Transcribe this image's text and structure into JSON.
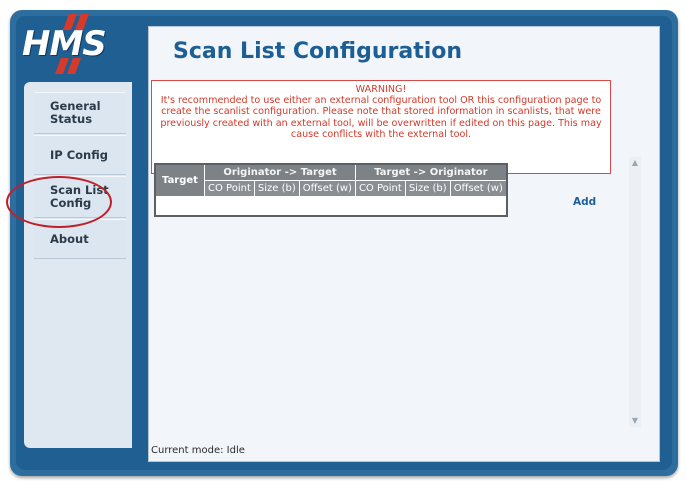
{
  "brand": {
    "logo_text": "HMS",
    "accent": "#d63a2a",
    "frame": "#2e6e9e"
  },
  "sidebar": {
    "items": [
      {
        "label_line1": "General",
        "label_line2": "Status"
      },
      {
        "label_line1": "IP Config",
        "label_line2": ""
      },
      {
        "label_line1": "Scan List",
        "label_line2": "Config",
        "selected": true
      },
      {
        "label_line1": "About",
        "label_line2": ""
      }
    ]
  },
  "main": {
    "title": "Scan List Configuration",
    "warning": {
      "head": "WARNING!",
      "body": "It's recommended to use either an external configuration tool OR this configuration page to create the scanlist configuration. Please note that stored information in scanlists, that were previously created with an external tool, will be overwritten if edited on this page. This may cause conflicts with the external tool."
    },
    "table": {
      "target_header": "Target",
      "groups": [
        "Originator -> Target",
        "Target -> Originator"
      ],
      "columns": [
        "CO Point",
        "Size (b)",
        "Offset (w)",
        "CO Point",
        "Size (b)",
        "Offset (w)"
      ]
    },
    "add_label": "Add",
    "mode_text": "Current mode: Idle"
  },
  "icons": {
    "scroll_up": "triangle-up",
    "scroll_down": "triangle-down"
  }
}
